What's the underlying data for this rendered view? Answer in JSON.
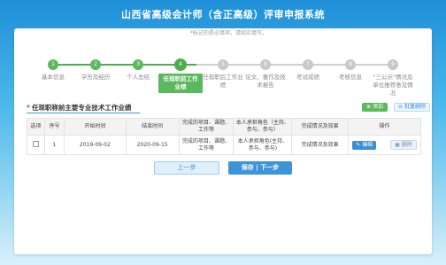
{
  "app": {
    "title": "山西省高级会计师（含正高级）评审申报系统"
  },
  "hint": "*标记的是必填项，请如实填写。",
  "steps": [
    {
      "num": "1",
      "label": "基本信息",
      "state": "done"
    },
    {
      "num": "2",
      "label": "学历及经历",
      "state": "done"
    },
    {
      "num": "3",
      "label": "个人总结",
      "state": "done"
    },
    {
      "num": "4",
      "label": "任现职前工作业绩",
      "state": "active"
    },
    {
      "num": "5",
      "label": "任现职后工作业绩",
      "state": "todo"
    },
    {
      "num": "6",
      "label": "论文、著作及技术报告",
      "state": "todo"
    },
    {
      "num": "7",
      "label": "考试成绩",
      "state": "todo"
    },
    {
      "num": "8",
      "label": "考核信息",
      "state": "todo"
    },
    {
      "num": "9",
      "label": "\"三公示\"情况及单位推荐意见情况",
      "state": "todo"
    }
  ],
  "section": {
    "required_mark": "*",
    "title": "任现职称前主要专业技术工作业绩",
    "add_label": "添加",
    "batch_delete_label": "批量删除"
  },
  "table": {
    "headers": [
      "选项",
      "序号",
      "开始时间",
      "结束时间",
      "完成的项目、课题、工作等",
      "本人承担角色（主持、参与、参与）",
      "完成情况及效果",
      "操作"
    ],
    "rows": [
      {
        "index": "1",
        "start": "2019-09-02",
        "end": "2020-09-15",
        "project": "完成的项目、课题、工作等",
        "role": "本人承担角色(主持、参与、参与)",
        "result": "完成情况及效果",
        "edit_label": "编辑",
        "delete_label": "删除"
      }
    ]
  },
  "nav": {
    "prev_label": "上一步",
    "next_label": "保存 | 下一步"
  }
}
